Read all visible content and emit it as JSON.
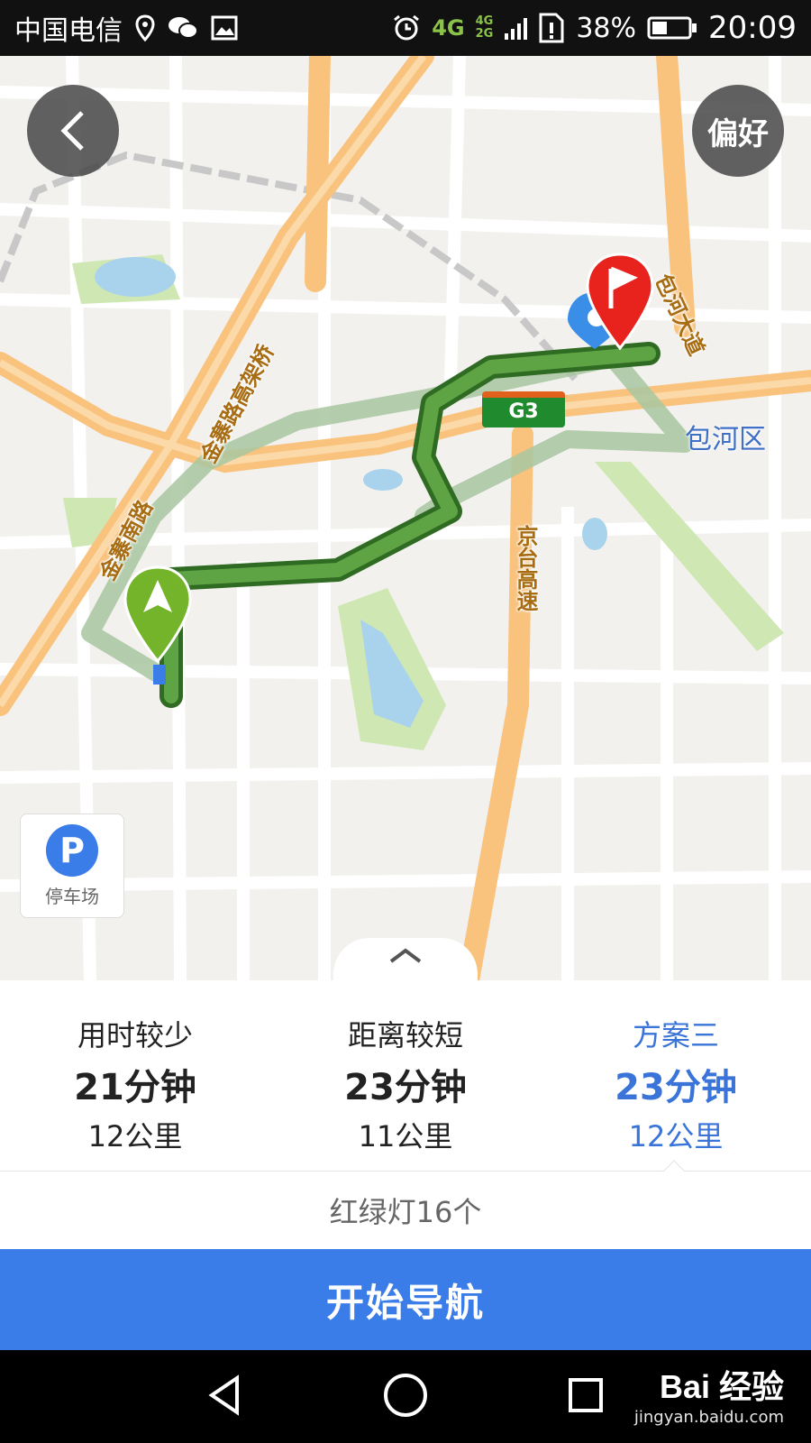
{
  "status_bar": {
    "carrier": "中国电信",
    "net_main": "4G",
    "net_top": "4G",
    "net_bottom": "2G",
    "battery": "38%",
    "time": "20:09",
    "icons": [
      "location-icon",
      "wechat-icon",
      "image-icon",
      "alarm-icon",
      "signal-icon",
      "sim-icon",
      "battery-icon"
    ]
  },
  "map": {
    "preference_label": "偏好",
    "parking_label": "停车场",
    "parking_symbol": "P",
    "highway_shield": "G3",
    "roads": {
      "jinzhai_elevated": "金寨路高架桥",
      "jinzhai_south": "金寨南路",
      "jingtai": "京台高速",
      "baohe_avenue": "包河大道"
    },
    "district": "包河区",
    "colors": {
      "route_selected": "#3e8c2d",
      "route_alt": "#9fbf95",
      "road": "#f9c27d",
      "water": "#a9d3ec",
      "park": "#cfe8b3"
    }
  },
  "routes": [
    {
      "name": "用时较少",
      "time": "21分钟",
      "distance": "12公里",
      "active": false
    },
    {
      "name": "距离较短",
      "time": "23分钟",
      "distance": "11公里",
      "active": false
    },
    {
      "name": "方案三",
      "time": "23分钟",
      "distance": "12公里",
      "active": true
    }
  ],
  "traffic_lights": "红绿灯16个",
  "start_nav_label": "开始导航",
  "watermark": {
    "logo": "Bai 经验",
    "url": "jingyan.baidu.com"
  },
  "accent_color": "#3a7ce8"
}
